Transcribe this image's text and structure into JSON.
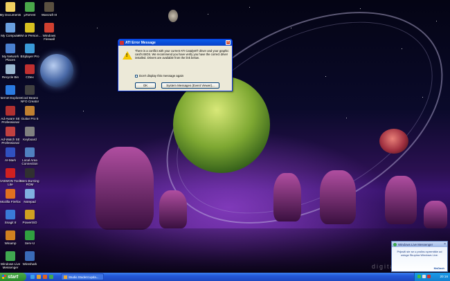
{
  "desktop": {
    "watermark": "digita",
    "icons": [
      {
        "label": "My Documents",
        "color": "#f0d060"
      },
      {
        "label": "µTorrent",
        "color": "#4aa84a"
      },
      {
        "label": "Warcraft III",
        "color": "#5a5040"
      },
      {
        "label": "My Computer",
        "color": "#6aa0e0"
      },
      {
        "label": "AIM or Person…",
        "color": "#d8c020"
      },
      {
        "label": "Windows Firewall",
        "color": "#d04030"
      },
      {
        "label": "My Network Places",
        "color": "#4a80d0"
      },
      {
        "label": "BSplayer Pro",
        "color": "#3a9ad8"
      },
      {
        "label": "Recycle Bin",
        "color": "#9ab8d0"
      },
      {
        "label": "CDex",
        "color": "#c03030"
      },
      {
        "label": "Internet Explorer",
        "color": "#2a7ae0"
      },
      {
        "label": "Cool Beans NFO Creator",
        "color": "#404040"
      },
      {
        "label": "Ad-Aware SE Professional",
        "color": "#b03030"
      },
      {
        "label": "Guitar Pro 5",
        "color": "#c08030"
      },
      {
        "label": "Ad-Watch SE Professional",
        "color": "#c04040"
      },
      {
        "label": "Keyboard",
        "color": "#808080"
      },
      {
        "label": "AI-Mark",
        "color": "#3050c0"
      },
      {
        "label": "Local Area Connection",
        "color": "#5080c0"
      },
      {
        "label": "DAEMON Tools Lite",
        "color": "#d02020"
      },
      {
        "label": "Nero Burning ROM",
        "color": "#303030"
      },
      {
        "label": "Mozilla Firefox",
        "color": "#e07020"
      },
      {
        "label": "Notepad",
        "color": "#80b0e0"
      },
      {
        "label": "Snagit 8",
        "color": "#3a7ad8"
      },
      {
        "label": "PowerISO",
        "color": "#d0a020"
      },
      {
        "label": "Winamp",
        "color": "#d08020"
      },
      {
        "label": "Serv-U",
        "color": "#30a040"
      },
      {
        "label": "Windows Live Messenger",
        "color": "#40a850"
      },
      {
        "label": "Wireshark",
        "color": "#3a6ab8"
      }
    ]
  },
  "dialog": {
    "title": "ATI Error Message",
    "close_glyph": "×",
    "warning_glyph": "!",
    "message": "There is a conflict with your current ATI Catalyst® driver and your graphic card's BIOS. We recommend you have verify you have the correct driver installed. Drivers are available from the link below.",
    "checkbox_label": "Don't display this message again",
    "ok_label": "OK",
    "system_messages_label": "System Messages (Event Viewer)..."
  },
  "toast": {
    "title": "Windows Live Messenger",
    "close_glyph": "×",
    "message": "Prijavili ste se u prolinu spremište od usluga Skupina Windows Live.",
    "brand": "MsDash"
  },
  "taskbar": {
    "start_label": "start",
    "task_label": "Studio Student upda...",
    "clock": "20:16"
  },
  "colors": {
    "dialog_title": "#0a5ee8",
    "taskbar": "#2458d8",
    "start": "#3a9a3a"
  }
}
